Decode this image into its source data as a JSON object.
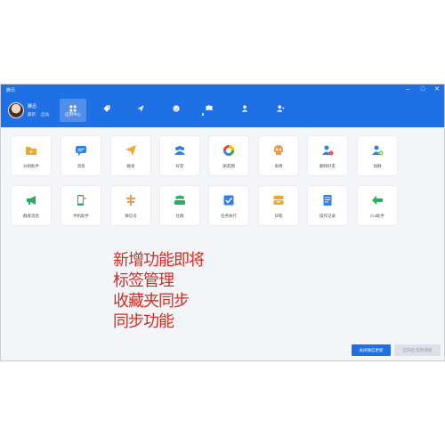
{
  "window": {
    "title": "腾讯"
  },
  "user": {
    "name": "腾迅",
    "status": "最新",
    "extra": "启动"
  },
  "nav": [
    {
      "icon": "grid-icon",
      "label": "应用中心",
      "active": true
    },
    {
      "icon": "tag-icon",
      "label": ""
    },
    {
      "icon": "send-icon",
      "label": ""
    },
    {
      "icon": "smile-icon",
      "label": ""
    },
    {
      "icon": "flag-icon",
      "label": ""
    },
    {
      "icon": "person-icon",
      "label": ""
    },
    {
      "icon": "person-add-icon",
      "label": ""
    }
  ],
  "apps": [
    {
      "label": "分组助手",
      "icon": "folder-icon",
      "color": "#f5a623"
    },
    {
      "label": "消息",
      "icon": "chat-icon",
      "color": "#2f80ed"
    },
    {
      "label": "群发",
      "icon": "paper-plane-icon",
      "color": "#f5a623"
    },
    {
      "label": "好友",
      "icon": "group-icon",
      "color": "#2f80ed"
    },
    {
      "label": "朋友圈",
      "icon": "camera-ring-icon",
      "color": "#34a853"
    },
    {
      "label": "表情",
      "icon": "skull-icon",
      "color": "#f2994a"
    },
    {
      "label": "删除好友",
      "icon": "user-delete-icon",
      "color": "#2f80ed"
    },
    {
      "label": "加群",
      "icon": "user-add-icon",
      "color": "#6fcf3f"
    },
    {
      "label": "群发消息",
      "icon": "megaphone-icon",
      "color": "#27ae60"
    },
    {
      "label": "手机助手",
      "icon": "phone-icon",
      "color": "#27ae60"
    },
    {
      "label": "微信号",
      "icon": "currency-icon",
      "color": "#f2994a"
    },
    {
      "label": "社群",
      "icon": "community-icon",
      "color": "#27ae60"
    },
    {
      "label": "任务执行",
      "icon": "checkbox-icon",
      "color": "#2f80ed"
    },
    {
      "label": "日程",
      "icon": "inbox-icon",
      "color": "#f5a623"
    },
    {
      "label": "操作记录",
      "icon": "document-icon",
      "color": "#2f80ed"
    },
    {
      "label": "Cut助手",
      "icon": "arrow-left-icon",
      "color": "#27ae60"
    }
  ],
  "notice": {
    "lines": [
      "新增功能即将",
      "标签管理",
      "收藏夹同步",
      "同步功能"
    ]
  },
  "buttons": {
    "primary": "关闭微信更新",
    "secondary": "已开启 实时消息"
  }
}
